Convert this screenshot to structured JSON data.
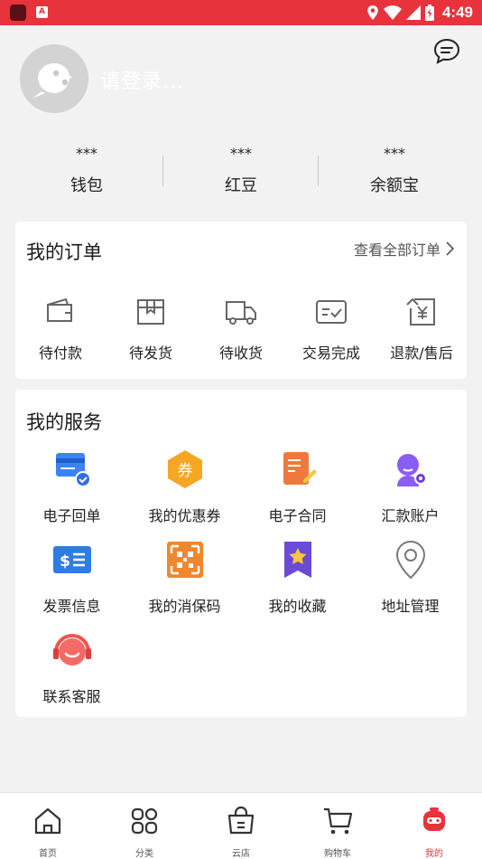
{
  "status_bar": {
    "time": "4:49",
    "app_badge": "A"
  },
  "header": {
    "login_text": "请登录...",
    "stats": [
      {
        "value": "***",
        "label": "钱包"
      },
      {
        "value": "***",
        "label": "红豆"
      },
      {
        "value": "***",
        "label": "余额宝"
      }
    ]
  },
  "orders": {
    "title": "我的订单",
    "view_all": "查看全部订单",
    "items": [
      {
        "label": "待付款",
        "icon": "wallet-icon"
      },
      {
        "label": "待发货",
        "icon": "package-icon"
      },
      {
        "label": "待收货",
        "icon": "truck-icon"
      },
      {
        "label": "交易完成",
        "icon": "check-card-icon"
      },
      {
        "label": "退款/售后",
        "icon": "refund-icon"
      }
    ]
  },
  "services": {
    "title": "我的服务",
    "items": [
      {
        "label": "电子回单",
        "icon": "receipt-icon"
      },
      {
        "label": "我的优惠券",
        "icon": "coupon-icon"
      },
      {
        "label": "电子合同",
        "icon": "contract-icon"
      },
      {
        "label": "汇款账户",
        "icon": "account-icon"
      },
      {
        "label": "发票信息",
        "icon": "invoice-icon"
      },
      {
        "label": "我的消保码",
        "icon": "qr-code-icon"
      },
      {
        "label": "我的收藏",
        "icon": "bookmark-star-icon"
      },
      {
        "label": "地址管理",
        "icon": "location-pin-icon"
      },
      {
        "label": "联系客服",
        "icon": "headset-icon"
      }
    ]
  },
  "bottom_nav": {
    "items": [
      {
        "label": "首页",
        "icon": "home-icon"
      },
      {
        "label": "分类",
        "icon": "grid-icon"
      },
      {
        "label": "云店",
        "icon": "store-bag-icon"
      },
      {
        "label": "购物车",
        "icon": "cart-icon"
      },
      {
        "label": "我的",
        "icon": "profile-icon"
      }
    ],
    "active": "我的"
  },
  "colors": {
    "accent": "#e8323c",
    "background": "#f2f2f2",
    "card": "#ffffff"
  }
}
